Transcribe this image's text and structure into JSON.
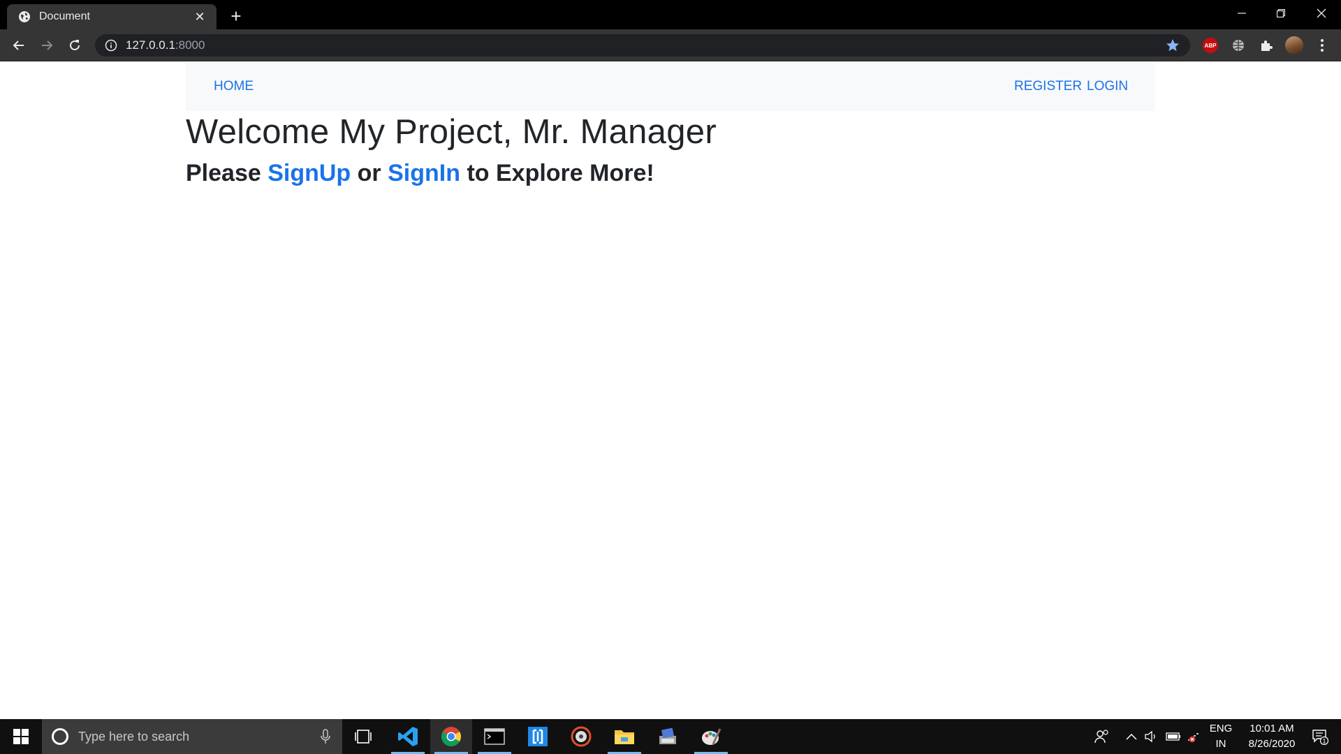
{
  "browser": {
    "tab_title": "Document",
    "tab_close": "✕",
    "new_tab": "+",
    "url_host": "127.0.0.1",
    "url_port": ":8000",
    "abp_label": "ABP"
  },
  "navbar": {
    "home": "HOME",
    "register": "REGISTER",
    "login": "LOGIN"
  },
  "main": {
    "heading": "Welcome My Project, Mr. Manager",
    "sub_please": "Please ",
    "sub_signup": "SignUp",
    "sub_or": " or ",
    "sub_signin": "SignIn",
    "sub_rest": " to Explore More!"
  },
  "taskbar": {
    "search_placeholder": "Type here to search",
    "lang_line1": "ENG",
    "lang_line2": "IN",
    "time": "10:01 AM",
    "date": "8/26/2020",
    "notification_count": "1"
  },
  "colors": {
    "link": "#1a73e8",
    "text": "#212529",
    "navbar_bg": "#f8f9fa"
  }
}
